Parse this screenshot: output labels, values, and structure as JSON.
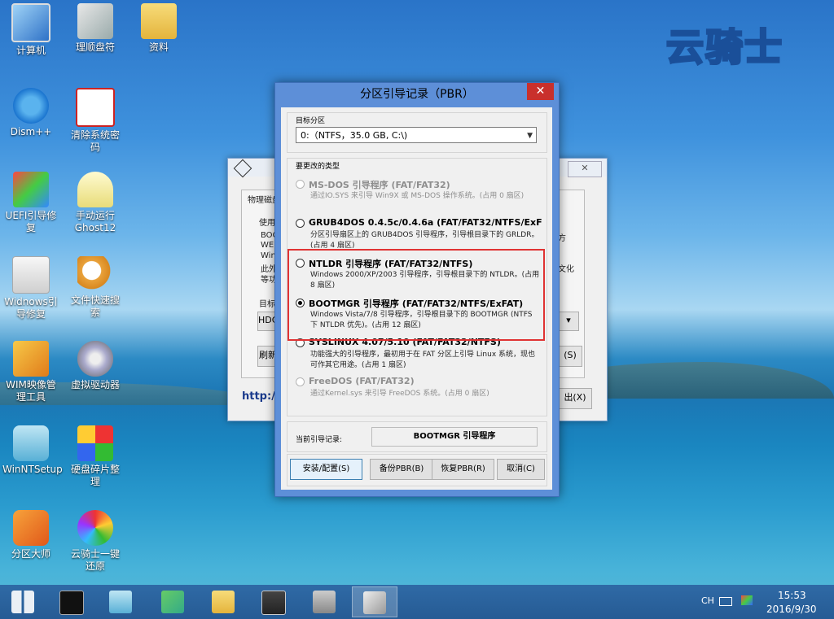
{
  "desktop": {
    "brand": "云骑士",
    "icons": [
      {
        "label": "计算机"
      },
      {
        "label": "理顺盘符"
      },
      {
        "label": "资料"
      },
      {
        "label": "Dism++"
      },
      {
        "label": "清除系统密码"
      },
      {
        "label": "UEFI引导修复"
      },
      {
        "label": "手动运行Ghost12"
      },
      {
        "label": "Widnows引导修复"
      },
      {
        "label": "文件快速搜索"
      },
      {
        "label": "WIM映像管理工具"
      },
      {
        "label": "虚拟驱动器"
      },
      {
        "label": "WinNTSetup"
      },
      {
        "label": "硬盘碎片整理"
      },
      {
        "label": "分区大师"
      },
      {
        "label": "云骑士一键还原"
      }
    ]
  },
  "background_window": {
    "group_label": "物理磁盘",
    "use_label": "使用",
    "lines": [
      "BOO",
      "WEI",
      "Win",
      "此外",
      "等功"
    ],
    "side_texts": [
      "方",
      "文化"
    ],
    "target_label": "目标",
    "target_value": "HDC",
    "refresh_button": "刷新",
    "s_button": "(S)",
    "exit_button": "出(X)",
    "link": "http:/"
  },
  "dialog": {
    "title": "分区引导记录（PBR）",
    "close": "✕",
    "target_caption": "目标分区",
    "target_value": "0:（NTFS，35.0 GB, C:\\)",
    "type_caption": "要更改的类型",
    "options": [
      {
        "name": "MS-DOS 引导程序 (FAT/FAT32)",
        "desc": "通过IO.SYS 来引导 Win9X 或 MS-DOS 操作系统。(占用 0 扇区)",
        "enabled": false,
        "selected": false
      },
      {
        "name": "GRUB4DOS 0.4.5c/0.4.6a (FAT/FAT32/NTFS/ExF",
        "desc": "分区引导扇区上的 GRUB4DOS 引导程序，引导根目录下的 GRLDR。(占用 4 扇区)",
        "enabled": true,
        "selected": false
      },
      {
        "name": "NTLDR 引导程序 (FAT/FAT32/NTFS)",
        "desc": "Windows 2000/XP/2003 引导程序，引导根目录下的 NTLDR。(占用 8 扇区)",
        "enabled": true,
        "selected": false
      },
      {
        "name": "BOOTMGR 引导程序 (FAT/FAT32/NTFS/ExFAT)",
        "desc": "Windows Vista/7/8 引导程序，引导根目录下的 BOOTMGR (NTFS 下 NTLDR 优先)。(占用 12 扇区)",
        "enabled": true,
        "selected": true
      },
      {
        "name": "SYSLINUX 4.07/5.10 (FAT/FAT32/NTFS)",
        "desc": "功能强大的引导程序，最初用于在 FAT 分区上引导 Linux 系统，现也可作其它用途。(占用 1 扇区)",
        "enabled": true,
        "selected": false
      },
      {
        "name": "FreeDOS (FAT/FAT32)",
        "desc": "通过Kernel.sys 来引导 FreeDOS 系统。(占用 0 扇区)",
        "enabled": false,
        "selected": false
      }
    ],
    "current_label": "当前引导记录:",
    "current_value": "BOOTMGR 引导程序",
    "buttons": {
      "install": "安装/配置(S)",
      "backup": "备份PBR(B)",
      "restore": "恢复PBR(R)",
      "cancel": "取消(C)"
    }
  },
  "taskbar": {
    "lang": "CH",
    "time": "15:53",
    "date": "2016/9/30"
  },
  "colors": {
    "highlight_box": "#e03333",
    "dialog_frame": "#5d8fd8",
    "close_button": "#c9302c"
  }
}
